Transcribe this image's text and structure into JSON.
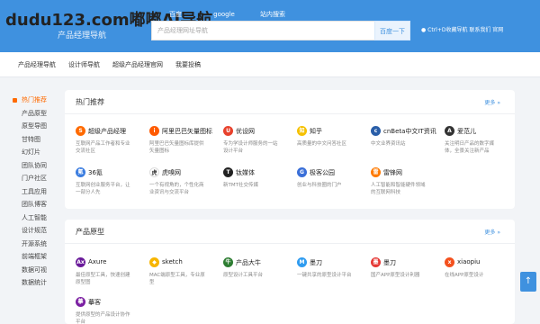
{
  "header": {
    "watermark": "dudu123.com嘟嘟AI导航",
    "subtitle": "产品经理导航",
    "tabs": [
      "百度",
      "google",
      "站内搜索"
    ],
    "search_placeholder": "产品经理网址导航",
    "search_button": "百度一下",
    "links": "● Ctrl+D收藏导航   联系我们  官网"
  },
  "nav": [
    "产品经理导航",
    "设计师导航",
    "超级产品经理官网",
    "我要投稿"
  ],
  "sidebar": [
    "热门推荐",
    "产品原型",
    "原型导图",
    "甘特图",
    "幻灯片",
    "团队协同",
    "门户社区",
    "工具应用",
    "团队博客",
    "人工智能",
    "设计规范",
    "开源系统",
    "前端框架",
    "数据可视",
    "数据统计"
  ],
  "card1": {
    "title": "热门推荐",
    "more": "更多 »",
    "sites": [
      {
        "name": "超级产品经理",
        "desc": "互联网产品工作者和专业交流社区",
        "icon": "S",
        "color": "#ff6a00"
      },
      {
        "name": "阿里巴巴矢量图标",
        "desc": "阿里巴巴矢量图标库提供矢量图标",
        "icon": "i",
        "color": "#ff5a00"
      },
      {
        "name": "优设网",
        "desc": "专为学设计师服务的一站设计平台",
        "icon": "U",
        "color": "#e8412c"
      },
      {
        "name": "知乎",
        "desc": "高质量的中文问答社区",
        "icon": "知",
        "color": "#f5c100"
      },
      {
        "name": "cnBeta中文IT资讯",
        "desc": "中文业界资讯站",
        "icon": "c",
        "color": "#2a5ea8"
      },
      {
        "name": "爱范儿",
        "desc": "关注明日产品的数字媒体，全景关注新产品",
        "icon": "A",
        "color": "#333333"
      },
      {
        "name": "36氪",
        "desc": "互联网创业服务平台，让一部分人先",
        "icon": "氪",
        "color": "#3b7de0"
      },
      {
        "name": "虎嗅网",
        "desc": "一个有视角的，个性化商业资讯与交流平台",
        "icon": "虎",
        "color": "#ffffff"
      },
      {
        "name": "钛媒体",
        "desc": "新TMT社交传媒",
        "icon": "T",
        "color": "#222222"
      },
      {
        "name": "极客公园",
        "desc": "创业与科技圈的门户",
        "icon": "G",
        "color": "#3a6fd8"
      },
      {
        "name": "雷锋网",
        "desc": "人工智能和智能硬件领域的互联网科技",
        "icon": "雷",
        "color": "#ff7a00"
      }
    ]
  },
  "card2": {
    "title": "产品原型",
    "more": "更多 »",
    "sites": [
      {
        "name": "Axure",
        "desc": "最佳原型工具，快速创建原型图",
        "icon": "Ax",
        "color": "#6a1b9a"
      },
      {
        "name": "sketch",
        "desc": "MAC端原型工具，专业原型",
        "icon": "◆",
        "color": "#f7b500"
      },
      {
        "name": "产品大牛",
        "desc": "原型设计工具平台",
        "icon": "牛",
        "color": "#2e7d32"
      },
      {
        "name": "墨刀",
        "desc": "一键共享的原型设计平台",
        "icon": "M",
        "color": "#2f9cf0"
      },
      {
        "name": "墨刀",
        "desc": "国产APP原型设计利器",
        "icon": "墨",
        "color": "#e53935"
      },
      {
        "name": "xiaopiu",
        "desc": "在线APP原型设计",
        "icon": "x",
        "color": "#f4511e"
      },
      {
        "name": "摹客",
        "desc": "提供原型的产品设计协作平台",
        "icon": "摹",
        "color": "#7b1fa2"
      }
    ]
  }
}
